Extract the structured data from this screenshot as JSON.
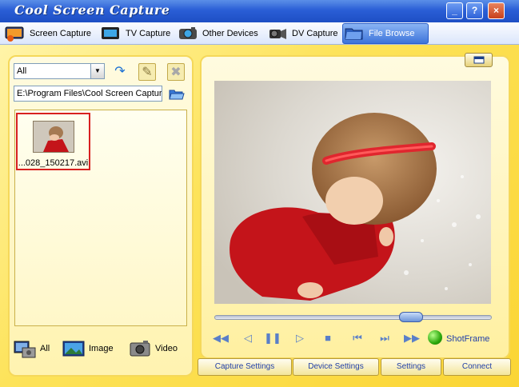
{
  "window": {
    "title": "Cool Screen Capture",
    "controls": {
      "minimize": "_",
      "help": "?",
      "close": "×"
    }
  },
  "tabs": [
    {
      "label": "Screen Capture",
      "icon": "screen-capture-icon",
      "active": false
    },
    {
      "label": "TV Capture",
      "icon": "tv-icon",
      "active": false
    },
    {
      "label": "Other Devices",
      "icon": "camera-icon",
      "active": false
    },
    {
      "label": "DV Capture",
      "icon": "camcorder-icon",
      "active": false
    },
    {
      "label": "File Browse",
      "icon": "folder-browse-icon",
      "active": true
    }
  ],
  "browser": {
    "filter_select": {
      "value": "All"
    },
    "path": "E:\\Program Files\\Cool Screen Capture",
    "files": [
      {
        "name": "...028_150217.avi",
        "selected": true
      }
    ],
    "filters": [
      {
        "label": "All",
        "icon": "all-files-icon"
      },
      {
        "label": "Image",
        "icon": "image-icon"
      },
      {
        "label": "Video",
        "icon": "video-camera-icon"
      }
    ]
  },
  "player": {
    "progress": 0.73,
    "controls": [
      "rewind",
      "previous",
      "pause",
      "play",
      "stop",
      "skip-back",
      "skip-forward",
      "fast-forward"
    ],
    "shot_frame_label": "ShotFrame"
  },
  "bottom_buttons": {
    "capture_settings": "Capture Settings",
    "device_settings": "Device Settings",
    "settings": "Settings",
    "connect": "Connect"
  },
  "colors": {
    "title_bar": "#2a5ed6",
    "panel_bg": "#fde35a",
    "selection_border": "#d82020",
    "button_text": "#2240a8"
  }
}
